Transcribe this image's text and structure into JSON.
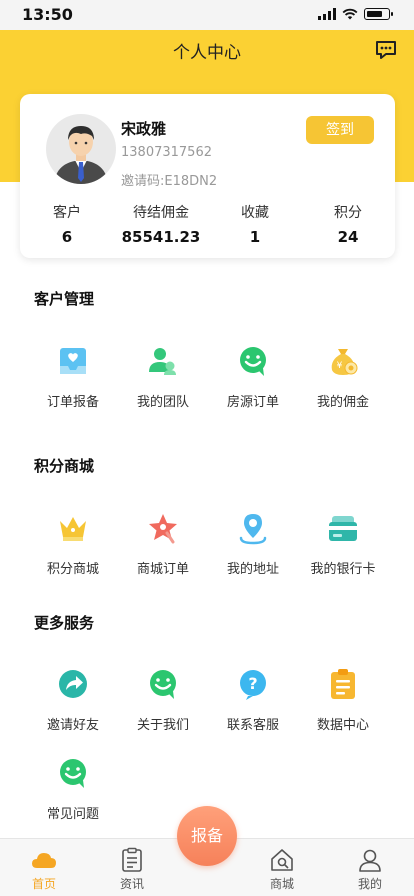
{
  "status_bar": {
    "time": "13:50"
  },
  "header": {
    "title": "个人中心",
    "message_icon": "chat-bubble-icon",
    "accent": "#fbd133"
  },
  "profile": {
    "name": "宋政雅",
    "phone": "13807317562",
    "invite_code": "邀请码:E18DN2",
    "checkin_label": "签到",
    "stats": [
      {
        "label": "客户",
        "value": "6"
      },
      {
        "label": "待结佣金",
        "value": "85541.23"
      },
      {
        "label": "收藏",
        "value": "1"
      },
      {
        "label": "积分",
        "value": "24"
      }
    ]
  },
  "sections": [
    {
      "title": "客户管理",
      "items": [
        {
          "label": "订单报备",
          "icon": "heart-inbox-icon"
        },
        {
          "label": "我的团队",
          "icon": "team-icon"
        },
        {
          "label": "房源订单",
          "icon": "chat-smile-icon"
        },
        {
          "label": "我的佣金",
          "icon": "money-bag-icon"
        }
      ]
    },
    {
      "title": "积分商城",
      "items": [
        {
          "label": "积分商城",
          "icon": "crown-icon"
        },
        {
          "label": "商城订单",
          "icon": "star-tag-icon"
        },
        {
          "label": "我的地址",
          "icon": "location-pin-icon"
        },
        {
          "label": "我的银行卡",
          "icon": "bank-card-icon"
        }
      ]
    },
    {
      "title": "更多服务",
      "items": [
        {
          "label": "邀请好友",
          "icon": "share-arrow-icon"
        },
        {
          "label": "关于我们",
          "icon": "chat-smile-icon"
        },
        {
          "label": "联系客服",
          "icon": "question-icon"
        },
        {
          "label": "数据中心",
          "icon": "clipboard-icon"
        },
        {
          "label": "常见问题",
          "icon": "chat-smile-icon"
        }
      ]
    }
  ],
  "tab_bar": {
    "tabs": [
      {
        "label": "首页",
        "icon": "home-cloud-icon",
        "active": true
      },
      {
        "label": "资讯",
        "icon": "news-doc-icon"
      },
      {
        "label": "商城",
        "icon": "shop-icon"
      },
      {
        "label": "我的",
        "icon": "user-icon"
      }
    ],
    "center_label": "报备"
  }
}
